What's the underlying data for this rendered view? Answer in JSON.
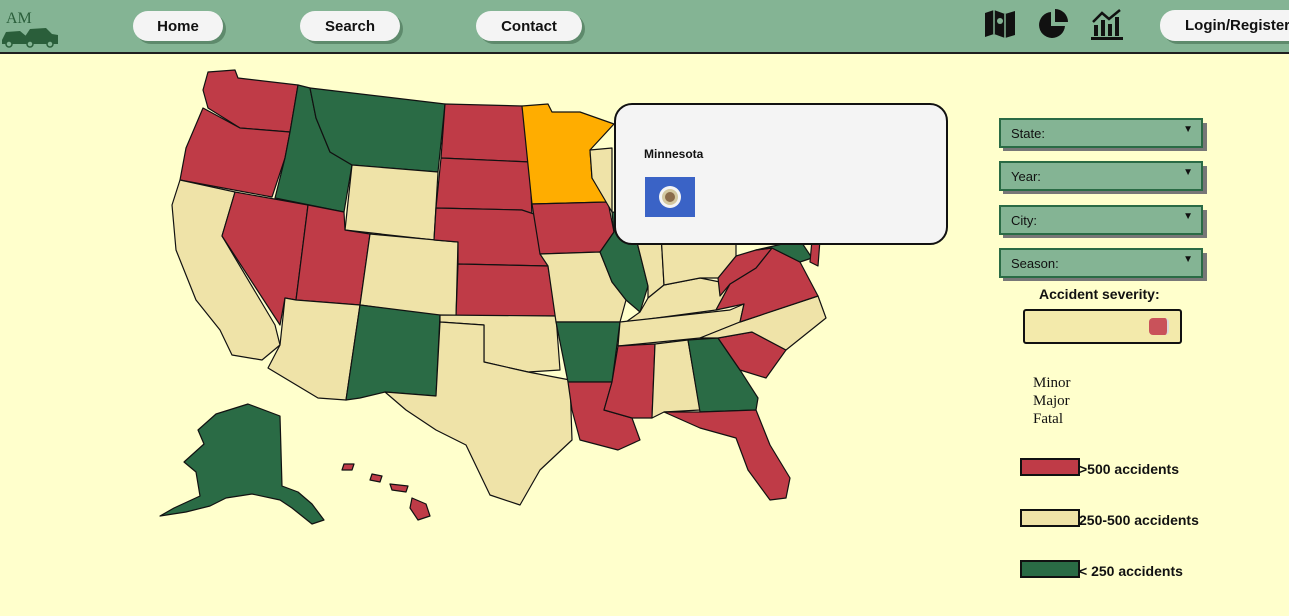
{
  "nav": {
    "logo_text": "AM",
    "home_label": "Home",
    "search_label": "Search",
    "contact_label": "Contact",
    "login_label": "Login/Register",
    "icons": [
      "map-icon",
      "pie-chart-icon",
      "bar-chart-icon"
    ]
  },
  "popup": {
    "state_name": "Minnesota"
  },
  "filters": {
    "state_label": "State:",
    "year_label": "Year:",
    "city_label": "City:",
    "season_label": "Season:",
    "caret": "▼"
  },
  "severity": {
    "title": "Accident severity:",
    "options": [
      "Minor",
      "Major",
      "Fatal"
    ]
  },
  "legend": {
    "high_label": ">500 accidents",
    "mid_label": "250-500 accidents",
    "low_label": "< 250 accidents"
  },
  "colors": {
    "nav_bg": "#84b494",
    "page_bg": "#ffffcc",
    "high": "#bf3b47",
    "mid": "#efe3a8",
    "low": "#2a6b45",
    "selected": "#ffad00"
  }
}
